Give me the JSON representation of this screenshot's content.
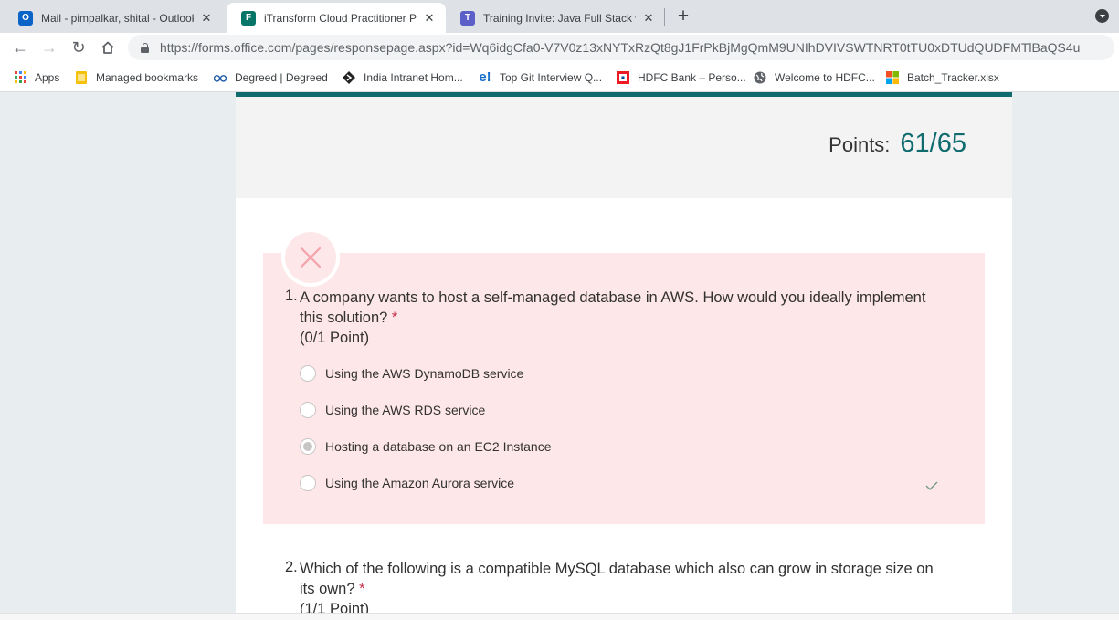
{
  "browser": {
    "tabs": [
      {
        "title": "Mail - pimpalkar, shital - Outlook",
        "icon": "outlook-icon",
        "icon_text": "O",
        "icon_color": "#0a64c8",
        "active": false
      },
      {
        "title": "iTransform Cloud Practitioner Pra",
        "icon": "forms-icon",
        "icon_text": "F",
        "icon_color": "#077568",
        "active": true
      },
      {
        "title": "Training Invite: Java Full Stack wit",
        "icon": "teams-icon",
        "icon_text": "T",
        "icon_color": "#5b5fc7",
        "active": false
      }
    ],
    "new_tab_label": "+",
    "url_host": "https://forms.office.com",
    "url_path": "/pages/responsepage.aspx?id=Wq6idgCfa0-V7V0z13xNYTxRzQt8gJ1FrPkBjMgQmM9UNIhDVIVSWTNRT0tTU0xDTUdQUDFMTlBaQS4u"
  },
  "bookmarks": [
    {
      "label": "Apps",
      "icon": "apps-grid-icon"
    },
    {
      "label": "Managed bookmarks",
      "icon": "folder-icon"
    },
    {
      "label": "Degreed | Degreed",
      "icon": "degreed-icon"
    },
    {
      "label": "India Intranet Hom...",
      "icon": "intranet-icon"
    },
    {
      "label": "Top Git Interview Q...",
      "icon": "edureka-icon"
    },
    {
      "label": "HDFC Bank – Perso...",
      "icon": "hdfc-icon"
    },
    {
      "label": "Welcome to HDFC...",
      "icon": "globe-icon"
    },
    {
      "label": "Batch_Tracker.xlsx",
      "icon": "microsoft-icon"
    }
  ],
  "form": {
    "points_label": "Points:",
    "points_value": "61/65",
    "accent_color": "#0f6b6e",
    "questions": [
      {
        "number": "1.",
        "text_line1": "A company wants to host a self-managed database in AWS. How would you ideally implement",
        "text_line2": "this solution?",
        "required_mark": "*",
        "score": "(0/1 Point)",
        "status": "incorrect",
        "options": [
          {
            "label": "Using the AWS DynamoDB service",
            "selected": false
          },
          {
            "label": "Using the AWS RDS service",
            "selected": false
          },
          {
            "label": "Hosting a database on an EC2 Instance",
            "selected": true
          },
          {
            "label": "Using the Amazon Aurora service",
            "selected": false,
            "correct": true
          }
        ]
      },
      {
        "number": "2.",
        "text_line1": "Which of the following is a compatible MySQL database which also can grow in storage size on",
        "text_line2": "its own?",
        "required_mark": "*",
        "score": "(1/1 Point)"
      }
    ]
  }
}
